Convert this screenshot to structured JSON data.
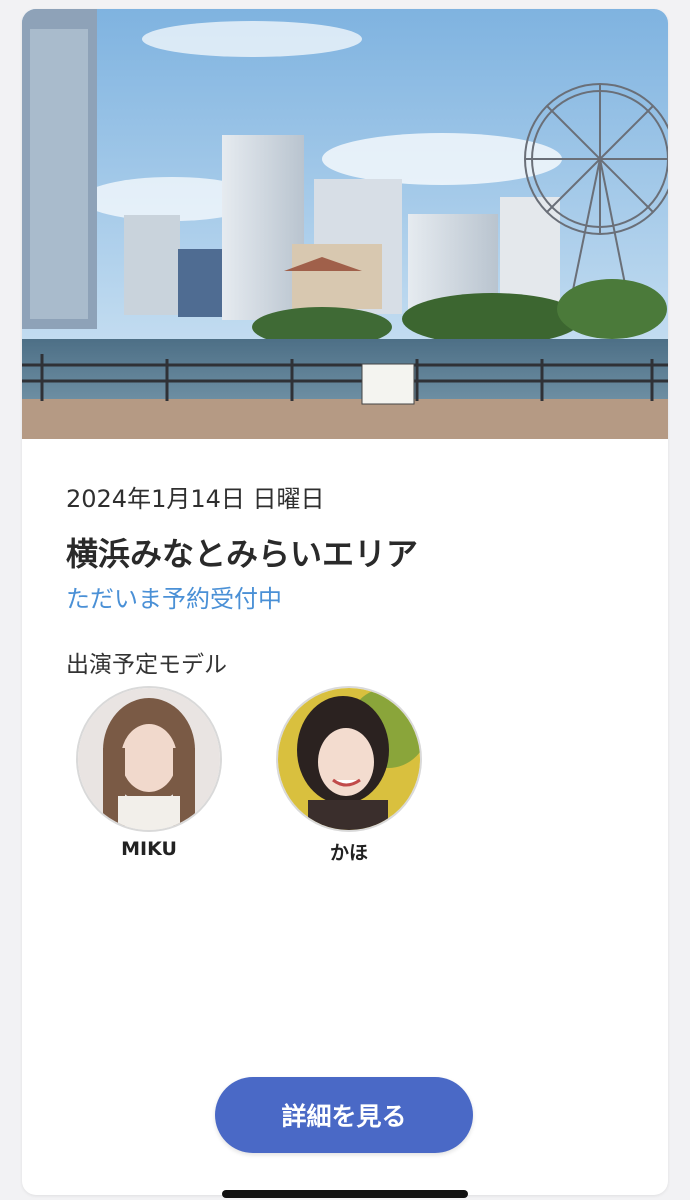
{
  "event": {
    "date": "2024年1月14日 日曜日",
    "title": "横浜みなとみらいエリア",
    "status": "ただいま予約受付中"
  },
  "models": {
    "label": "出演予定モデル",
    "items": [
      {
        "name": "MIKU"
      },
      {
        "name": "かほ"
      }
    ]
  },
  "actions": {
    "detail_label": "詳細を見る"
  },
  "colors": {
    "accent": "#4a69c6",
    "status": "#4a90d6"
  }
}
